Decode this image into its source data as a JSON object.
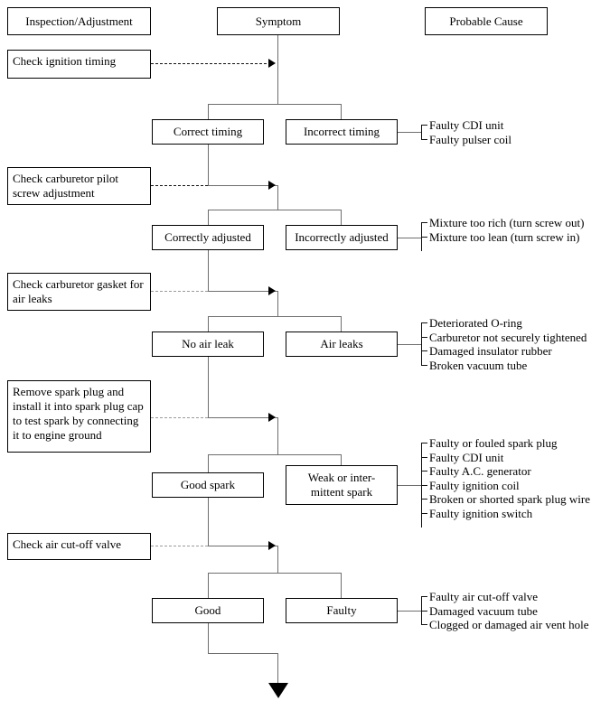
{
  "headers": {
    "inspection": "Inspection/Adjustment",
    "symptom": "Symptom",
    "probable_cause": "Probable Cause"
  },
  "steps": [
    {
      "id": "check-ignition-timing",
      "label": "Check ignition timing"
    },
    {
      "id": "check-carburetor-pilot",
      "label": "Check carburetor pilot screw adjustment"
    },
    {
      "id": "check-carburetor-gasket",
      "label": "Check carburetor gasket for air leaks"
    },
    {
      "id": "remove-spark-plug",
      "label": "Remove spark plug and install it into spark plug cap to test spark by connecting it to engine ground"
    },
    {
      "id": "check-air-cut-off-valve",
      "label": "Check air cut-off valve"
    }
  ],
  "branches": [
    {
      "id": "timing",
      "pass_label": "Correct timing",
      "fail_label": "Incorrect timing",
      "causes": [
        "Faulty CDI unit",
        "Faulty pulser coil"
      ]
    },
    {
      "id": "pilot-screw",
      "pass_label": "Correctly adjusted",
      "fail_label": "Incorrectly adjusted",
      "causes": [
        "Mixture too rich (turn screw out)",
        "Mixture too lean (turn screw in)"
      ]
    },
    {
      "id": "air-leak",
      "pass_label": "No air leak",
      "fail_label": "Air leaks",
      "causes": [
        "Deteriorated O-ring",
        "Carburetor not securely tightened",
        "Damaged insulator rubber",
        "Broken vacuum tube"
      ]
    },
    {
      "id": "spark",
      "pass_label": "Good spark",
      "fail_label": "Weak or inter-\nmittent spark",
      "causes": [
        "Faulty or fouled spark plug",
        "Faulty CDI unit",
        "Faulty A.C. generator",
        "Faulty ignition coil",
        "Broken or shorted spark plug wire",
        "Faulty ignition switch"
      ]
    },
    {
      "id": "air-cut-off",
      "pass_label": "Good",
      "fail_label": "Faulty",
      "causes": [
        "Faulty air cut-off valve",
        "Damaged vacuum tube",
        "Clogged or damaged air vent hole"
      ]
    }
  ],
  "colors": {
    "line": "#6e6e6e",
    "text": "#000000",
    "border": "#000000",
    "background": "#ffffff"
  }
}
